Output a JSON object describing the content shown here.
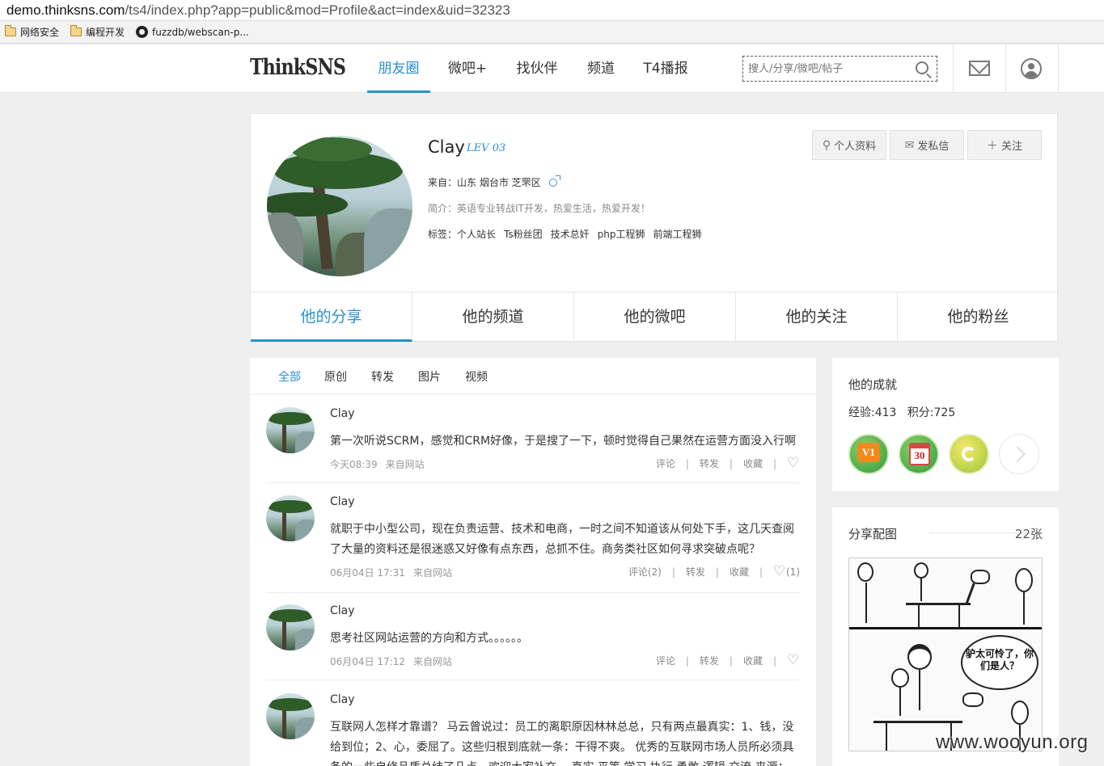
{
  "browser": {
    "url_host": "demo.thinksns.com",
    "url_path": "/ts4/index.php?app=public&mod=Profile&act=index&uid=32323",
    "bookmarks": [
      "网络安全",
      "编程开发",
      "fuzzdb/webscan-p..."
    ]
  },
  "topnav": {
    "logo": "ThinkSNS",
    "items": [
      "朋友圈",
      "微吧+",
      "找伙伴",
      "频道",
      "T4播报"
    ],
    "active_index": 0,
    "search_placeholder": "搜人/分享/微吧/帖子"
  },
  "profile": {
    "name": "Clay",
    "level": "LEV 03",
    "location": "来自：山东 烟台市 芝罘区",
    "intro": "简介：英语专业转战IT开发，热爱生活，热爱开发！",
    "tags_label": "标签：",
    "tags": [
      "个人站长",
      "Ts粉丝团",
      "技术总奸",
      "php工程狮",
      "前端工程狮"
    ],
    "buttons": [
      "个人资料",
      "发私信",
      "关注"
    ],
    "tabs": [
      "他的分享",
      "他的频道",
      "他的微吧",
      "他的关注",
      "他的粉丝"
    ],
    "active_tab": 0
  },
  "feed": {
    "filters": [
      "全部",
      "原创",
      "转发",
      "图片",
      "视频"
    ],
    "active_filter": 0,
    "posts": [
      {
        "author": "Clay",
        "text": "第一次听说SCRM，感觉和CRM好像，于是搜了一下，顿时觉得自己果然在运营方面没入行啊",
        "time": "今天08:39",
        "source": "来自网站",
        "comment": "评论",
        "forward": "转发",
        "favorite": "收藏",
        "likes": ""
      },
      {
        "author": "Clay",
        "text": "就职于中小型公司，现在负责运营、技术和电商，一时之间不知道该从何处下手，这几天查阅了大量的资料还是很迷惑又好像有点东西，总抓不住。商务类社区如何寻求突破点呢？",
        "time": "06月04日 17:31",
        "source": "来自网站",
        "comment": "评论(2)",
        "forward": "转发",
        "favorite": "收藏",
        "likes": "(1)"
      },
      {
        "author": "Clay",
        "text": "思考社区网站运营的方向和方式。。。。。。",
        "time": "06月04日 17:12",
        "source": "来自网站",
        "comment": "评论",
        "forward": "转发",
        "favorite": "收藏",
        "likes": ""
      },
      {
        "author": "Clay",
        "text": "互联网人怎样才靠谱？ 马云曾说过：员工的离职原因林林总总，只有两点最真实：1、钱，没给到位；2、心，委屈了。这些归根到底就一条：干得不爽。 优秀的互联网市场人员所必须具备的一些自修品质总结了几点，欢迎大家补充。 真实 平等 学习 执行 勇敢 逻辑 交流 来源：",
        "time": "",
        "source": "",
        "comment": "",
        "forward": "",
        "favorite": "",
        "likes": ""
      }
    ]
  },
  "achievements": {
    "title": "他的成就",
    "exp": "经验:413",
    "score": "积分:725",
    "badges": [
      "V1",
      "30"
    ]
  },
  "gallery": {
    "title": "分享配图",
    "count": "22张",
    "bubble": "驴太可怜了，你们是人？"
  },
  "watermark": "www.wooyun.org",
  "colors": {
    "accent": "#2a8fd0",
    "background": "#efefef"
  }
}
